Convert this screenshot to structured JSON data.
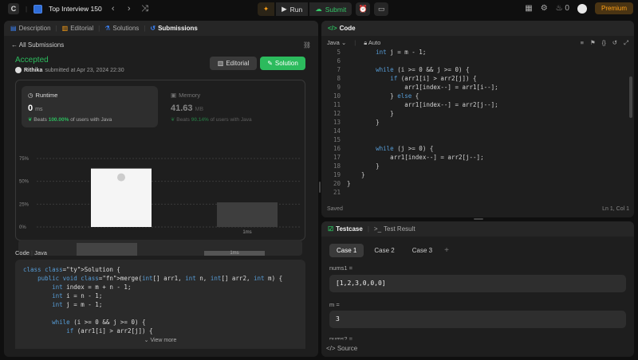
{
  "topbar": {
    "list_title": "Top Interview 150",
    "prev": "‹",
    "next": "›",
    "shuffle": "⤨",
    "run_label": "Run",
    "submit_label": "Submit",
    "streak": "0",
    "premium_label": "Premium"
  },
  "left_tabs": [
    {
      "label": "Description"
    },
    {
      "label": "Editorial"
    },
    {
      "label": "Solutions"
    },
    {
      "label": "Submissions"
    }
  ],
  "submission": {
    "back_label": "All Submissions",
    "status": "Accepted",
    "user": "Rithika",
    "submitted_text": "submitted at Apr 23, 2024 22:30",
    "editorial_btn": "Editorial",
    "solution_btn": "Solution"
  },
  "runtime": {
    "label": "Runtime",
    "value": "0",
    "unit": "ms",
    "beats_prefix": "Beats",
    "beats_pct": "100.00%",
    "beats_suffix": "of users with Java"
  },
  "memory": {
    "label": "Memory",
    "value": "41.63",
    "unit": "MB",
    "beats_prefix": "Beats",
    "beats_pct": "90.14%",
    "beats_suffix": "of users with Java"
  },
  "chart_data": {
    "type": "bar",
    "y_ticks": [
      "75%",
      "50%",
      "25%",
      "0%"
    ],
    "ylim": [
      0,
      75
    ],
    "bars": [
      {
        "x_label": "",
        "value": 64,
        "highlight": true
      },
      {
        "x_label": "1ms",
        "value": 27,
        "highlight": false
      }
    ],
    "mini_label": "1ms"
  },
  "code_section": {
    "label": "Code",
    "lang": "Java",
    "view_more": "View more",
    "lines": [
      "class Solution {",
      "    public void merge(int[] arr1, int n, int[] arr2, int m) {",
      "        int index = m + n - 1;",
      "        int i = n - 1;",
      "        int j = m - 1;",
      "",
      "        while (i >= 0 && j >= 0) {",
      "            if (arr1[i] > arr2[j]) {"
    ]
  },
  "editor": {
    "title": "Code",
    "language": "Java",
    "mode": "Auto",
    "saved": "Saved",
    "cursor": "Ln 1, Col 1",
    "lines": [
      {
        "n": "5",
        "t": "        int j = m - 1;"
      },
      {
        "n": "6",
        "t": ""
      },
      {
        "n": "7",
        "t": "        while (i >= 0 && j >= 0) {"
      },
      {
        "n": "8",
        "t": "            if (arr1[i] > arr2[j]) {"
      },
      {
        "n": "9",
        "t": "                arr1[index--] = arr1[i--];"
      },
      {
        "n": "10",
        "t": "            } else {"
      },
      {
        "n": "11",
        "t": "                arr1[index--] = arr2[j--];"
      },
      {
        "n": "12",
        "t": "            }"
      },
      {
        "n": "13",
        "t": "        }"
      },
      {
        "n": "14",
        "t": ""
      },
      {
        "n": "15",
        "t": ""
      },
      {
        "n": "16",
        "t": "        while (j >= 0) {"
      },
      {
        "n": "17",
        "t": "            arr1[index--] = arr2[j--];"
      },
      {
        "n": "18",
        "t": "        }"
      },
      {
        "n": "19",
        "t": "    }"
      },
      {
        "n": "20",
        "t": "}"
      },
      {
        "n": "21",
        "t": ""
      }
    ]
  },
  "testpanel": {
    "tab_testcase": "Testcase",
    "tab_result": "Test Result",
    "cases": [
      "Case 1",
      "Case 2",
      "Case 3"
    ],
    "plus": "+",
    "fields": [
      {
        "label": "nums1 =",
        "value": "[1,2,3,0,0,0]"
      },
      {
        "label": "m =",
        "value": "3"
      },
      {
        "label": "nums2 =",
        "value": ""
      }
    ],
    "source_label": "Source"
  },
  "colors": {
    "accent_green": "#2cbb5d",
    "accent_orange": "#ffa116",
    "keyword_blue": "#569cd6"
  }
}
